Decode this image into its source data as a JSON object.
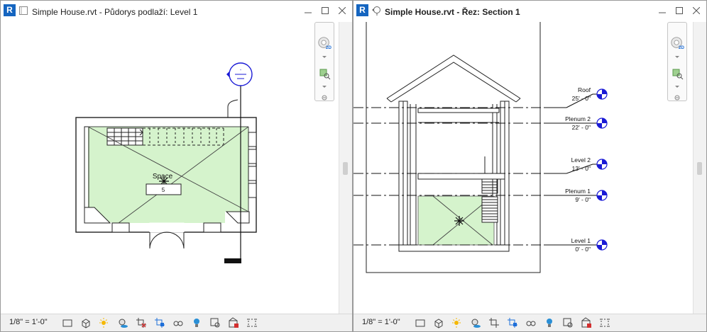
{
  "app": {
    "logo_letter": "R"
  },
  "left": {
    "title": "Simple House.rvt - Půdorys podlaží: Level 1",
    "scale": "1/8\" = 1'-0\"",
    "space_label": "Space",
    "space_number": "5",
    "room_tag": "-",
    "view_icon": "floor-plan-icon"
  },
  "right": {
    "title": "Simple House.rvt - Řez: Section 1",
    "scale": "1/8\" = 1'-0\"",
    "view_icon": "section-icon",
    "levels": [
      {
        "name": "Roof",
        "elevation": "25' - 0\""
      },
      {
        "name": "Plenum 2",
        "elevation": "22' - 0\""
      },
      {
        "name": "Level 2",
        "elevation": "13' - 0\""
      },
      {
        "name": "Plenum 1",
        "elevation": "9' - 0\""
      },
      {
        "name": "Level 1",
        "elevation": "0' - 0\""
      }
    ]
  },
  "navbar": {
    "badge": "2D"
  },
  "colors": {
    "space_fill": "#d5f3cc",
    "level_marker": "#1a1ad6",
    "title_text": "#222222"
  }
}
